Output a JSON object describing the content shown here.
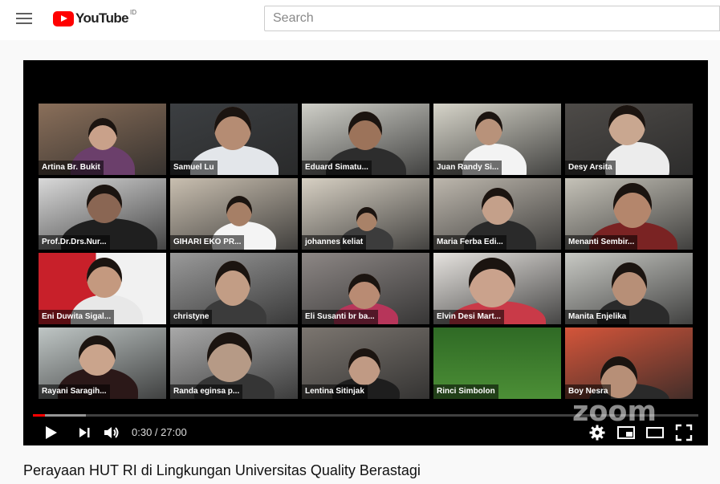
{
  "header": {
    "logo_text": "YouTube",
    "region": "ID",
    "search_placeholder": "Search"
  },
  "player": {
    "participants": [
      {
        "name": "Artina Br. Bukit"
      },
      {
        "name": "Samuel Lu"
      },
      {
        "name": "Eduard Simatu..."
      },
      {
        "name": "Juan Randy Si..."
      },
      {
        "name": "Desy Arsita"
      },
      {
        "name": "Prof.Dr.Drs.Nur..."
      },
      {
        "name": "GIHARI EKO PR..."
      },
      {
        "name": "johannes keliat"
      },
      {
        "name": "Maria Ferba Edi..."
      },
      {
        "name": "Menanti Sembir..."
      },
      {
        "name": "Eni Duwita Sigal..."
      },
      {
        "name": "christyne"
      },
      {
        "name": "Eli Susanti br ba..."
      },
      {
        "name": "Elvin Desi Mart..."
      },
      {
        "name": "Manita Enjelika"
      },
      {
        "name": "Rayani Saragih..."
      },
      {
        "name": "Randa eginsa p..."
      },
      {
        "name": "Lentina Sitinjak"
      },
      {
        "name": "Rinci Simbolon"
      },
      {
        "name": "Boy Nesra"
      }
    ],
    "watermark": "zoom",
    "time_current": "0:30",
    "time_total": "27:00",
    "time_display": "0:30 / 27:00",
    "progress_fraction": 0.0185,
    "buffered_fraction": 0.08
  },
  "video": {
    "title": "Perayaan HUT RI di Lingkungan Universitas Quality Berastagi"
  }
}
